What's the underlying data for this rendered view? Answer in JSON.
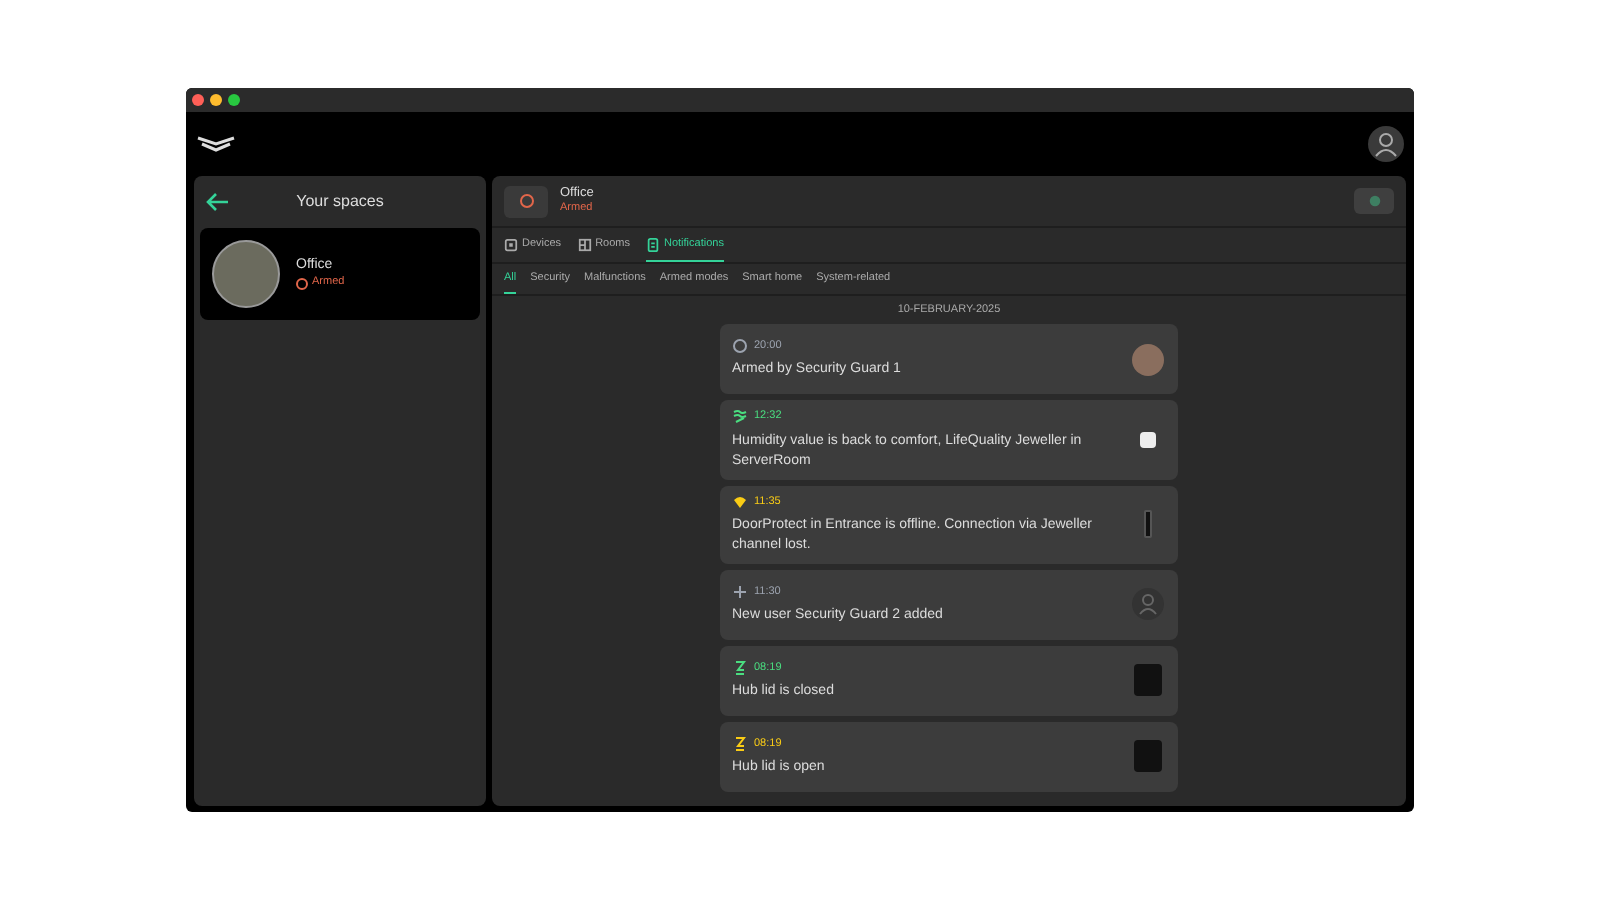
{
  "sidebar": {
    "title": "Your spaces",
    "spaces": [
      {
        "name": "Office",
        "status": "Armed",
        "selected": true
      }
    ]
  },
  "space": {
    "name": "Office",
    "status": "Armed"
  },
  "tabs": [
    {
      "label": "Devices",
      "selected": false
    },
    {
      "label": "Rooms",
      "selected": false
    },
    {
      "label": "Notifications",
      "selected": true
    }
  ],
  "filters": [
    {
      "label": "All",
      "selected": true
    },
    {
      "label": "Security",
      "selected": false
    },
    {
      "label": "Malfunctions",
      "selected": false
    },
    {
      "label": "Armed modes",
      "selected": false
    },
    {
      "label": "Smart home",
      "selected": false
    },
    {
      "label": "System-related",
      "selected": false
    }
  ],
  "date": "10-FEBRUARY-2025",
  "notifications": [
    {
      "kind": "armed",
      "color": "#9ca3af",
      "time": "20:00",
      "text": "Armed by Security Guard 1"
    },
    {
      "kind": "humidity",
      "color": "#4ade80",
      "time": "12:32",
      "text": "Humidity value is back to comfort, LifeQuality Jeweller in ServerRoom"
    },
    {
      "kind": "offline",
      "color": "#facc15",
      "time": "11:35",
      "text": "DoorProtect in Entrance is offline. Connection via Jeweller channel lost."
    },
    {
      "kind": "user",
      "color": "#9ca3af",
      "time": "11:30",
      "text": "New user Security Guard 2 added"
    },
    {
      "kind": "lid",
      "color": "#4ade80",
      "time": "08:19",
      "text": "Hub lid is closed"
    },
    {
      "kind": "lid",
      "color": "#facc15",
      "time": "08:19",
      "text": "Hub lid is open"
    }
  ]
}
